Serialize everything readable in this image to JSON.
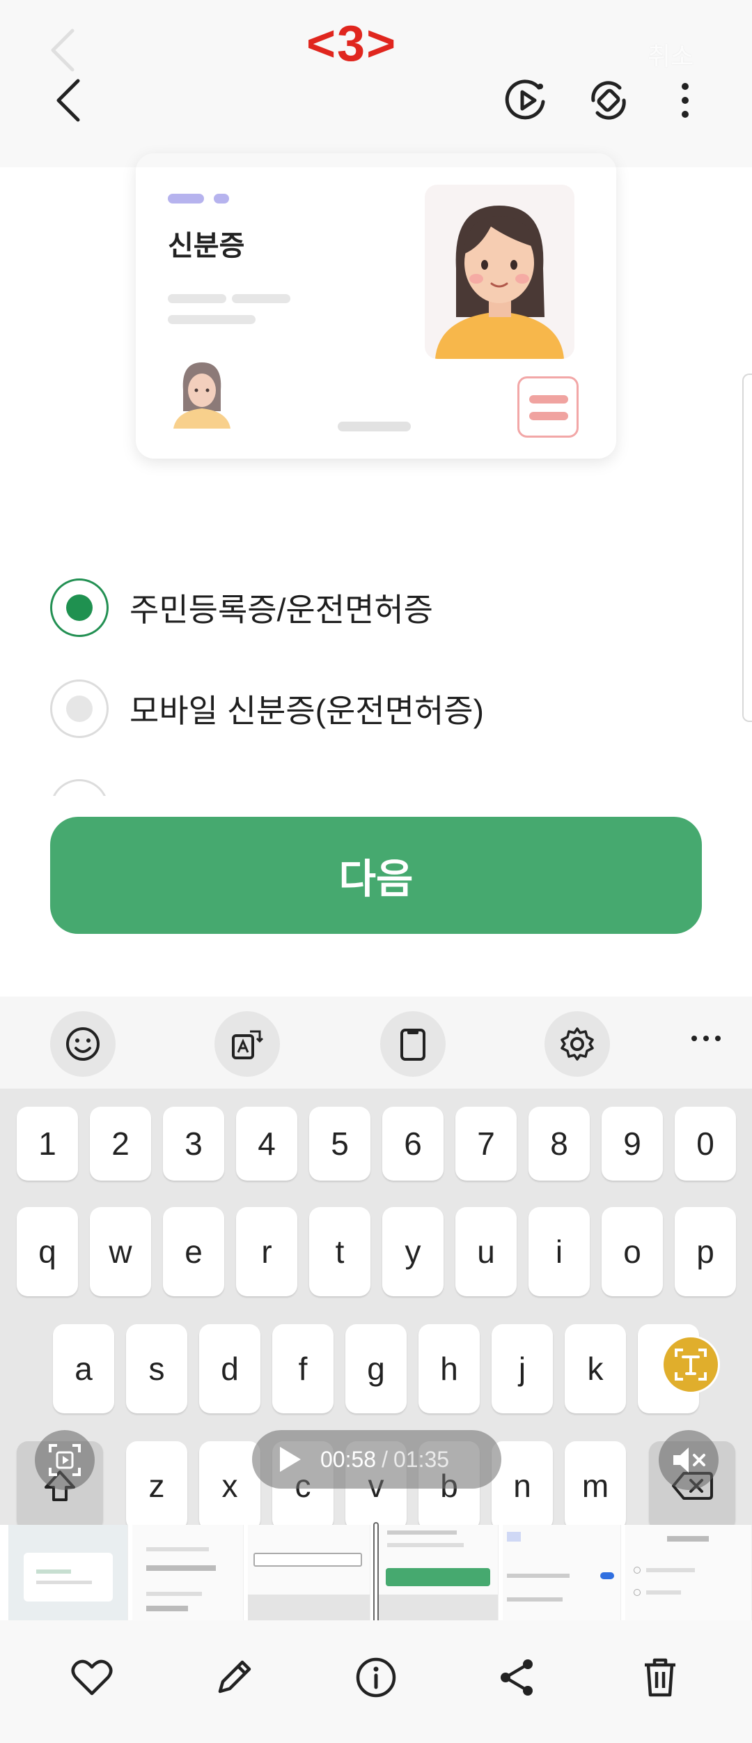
{
  "header": {
    "step_label": "<3>",
    "ghost_cancel": "취소",
    "icons": [
      "back-icon",
      "motion-play-icon",
      "auto-rotate-icon",
      "more-vertical-icon"
    ]
  },
  "card": {
    "title": "신분증"
  },
  "options": [
    {
      "label": "주민등록증/운전면허증",
      "selected": true
    },
    {
      "label": "모바일 신분증(운전면허증)",
      "selected": false
    }
  ],
  "next_button": "다음",
  "keyboard": {
    "toolbar_icons": [
      "emoji-icon",
      "translate-icon",
      "clipboard-icon",
      "settings-icon",
      "more-horizontal-icon"
    ],
    "row_numbers": [
      "1",
      "2",
      "3",
      "4",
      "5",
      "6",
      "7",
      "8",
      "9",
      "0"
    ],
    "row_q": [
      "q",
      "w",
      "e",
      "r",
      "t",
      "y",
      "u",
      "i",
      "o",
      "p"
    ],
    "row_a": [
      "a",
      "s",
      "d",
      "f",
      "g",
      "h",
      "j",
      "k",
      "l"
    ],
    "row_z": [
      "z",
      "x",
      "c",
      "v",
      "b",
      "n",
      "m"
    ]
  },
  "video": {
    "current_time": "00:58",
    "separator": "/",
    "total_time": "01:35"
  },
  "colors": {
    "accent_green": "#46a96f",
    "radio_green": "#1f9150",
    "step_red": "#e0261e"
  },
  "actions": [
    "heart-icon",
    "edit-icon",
    "info-icon",
    "share-icon",
    "delete-icon"
  ]
}
